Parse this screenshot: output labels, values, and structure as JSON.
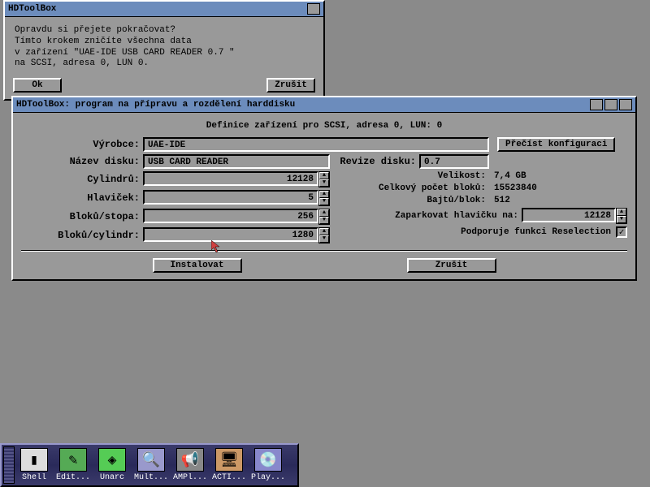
{
  "dialog": {
    "title": "HDToolBox",
    "message": "Opravdu si přejete pokračovat?\nTímto krokem zničíte všechna data\nv zařízení \"UAE-IDE USB CARD READER 0.7 \"\nna SCSI, adresa 0, LUN 0.",
    "ok": "Ok",
    "cancel": "Zrušit"
  },
  "main": {
    "title": "HDToolBox: program na přípravu a rozdělení harddisku",
    "subtitle": "Definice zařízení pro SCSI, adresa 0, LUN: 0",
    "labels": {
      "manufacturer": "Výrobce:",
      "disk_name": "Název disku:",
      "revision": "Revize disku:",
      "cylinders": "Cylindrů:",
      "heads": "Hlaviček:",
      "blocks_track": "Bloků/stopa:",
      "bytes_block": "Bajtů/blok:",
      "blocks_cyl": "Bloků/cylindr:",
      "size": "Velikost:",
      "total_blocks": "Celkový počet bloků:",
      "park": "Zaparkovat hlavičku na:",
      "reselection": "Podporuje funkci Reselection"
    },
    "values": {
      "manufacturer": "UAE-IDE",
      "disk_name": "USB CARD READER",
      "revision": "0.7",
      "cylinders": "12128",
      "heads": "5",
      "blocks_track": "256",
      "bytes_block": "512",
      "blocks_cyl": "1280",
      "size": "7,4 GB",
      "total_blocks": "15523840",
      "park": "12128"
    },
    "buttons": {
      "read_config": "Přečíst konfiguraci",
      "install": "Instalovat",
      "cancel": "Zrušit"
    }
  },
  "dock": {
    "items": [
      {
        "label": "Shell"
      },
      {
        "label": "Edit..."
      },
      {
        "label": "Unarc"
      },
      {
        "label": "Mult..."
      },
      {
        "label": "AMPl..."
      },
      {
        "label": "ACTI..."
      },
      {
        "label": "Play..."
      }
    ]
  }
}
